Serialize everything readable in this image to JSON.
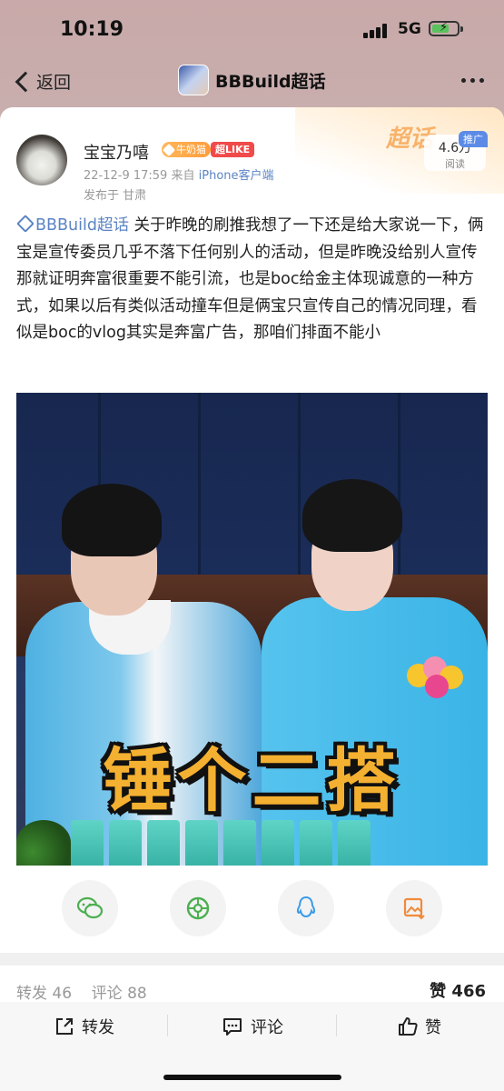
{
  "status_bar": {
    "time": "10:19",
    "network": "5G"
  },
  "nav": {
    "back_label": "返回",
    "title": "BBBuild超话"
  },
  "post": {
    "author": "宝宝乃嘻",
    "badge_fan": "牛奶猫",
    "badge_like": "超LIKE",
    "timestamp": "22-12-9 17:59",
    "source_prefix": "来自",
    "source": "iPhone客户端",
    "location": "发布于 甘肃",
    "reads_count": "4.6万",
    "reads_label": "阅读",
    "promo_tag": "推广",
    "chaohua_deco": "超话",
    "topic_tag": "BBBuild超话",
    "text": "关于昨晚的刷推我想了一下还是给大家说一下，俩宝是宣传委员几乎不落下任何别人的活动，但是昨晚没给别人宣传那就证明奔富很重要不能引流，也是boc给金主体现诚意的一种方式，如果以后有类似活动撞车但是俩宝只宣传自己的情况同理，看似是boc的vlog其实是奔富广告，那咱们排面不能小",
    "image_caption": "锤个二搭"
  },
  "share_buttons": [
    {
      "icon": "wechat-icon",
      "color": "#4caf50"
    },
    {
      "icon": "moments-icon",
      "color": "#4caf50"
    },
    {
      "icon": "qq-icon",
      "color": "#3a9be8"
    },
    {
      "icon": "save-image-icon",
      "color": "#f08a3c"
    }
  ],
  "stats": {
    "repost": "转发 46",
    "comment": "评论 88",
    "like_label": "赞",
    "like_count": "466"
  },
  "actions": {
    "repost": "转发",
    "comment": "评论",
    "like": "赞"
  },
  "colors": {
    "link": "#5b84c4",
    "badge_orange": "#ff9c3b",
    "badge_red": "#f14a4a"
  }
}
